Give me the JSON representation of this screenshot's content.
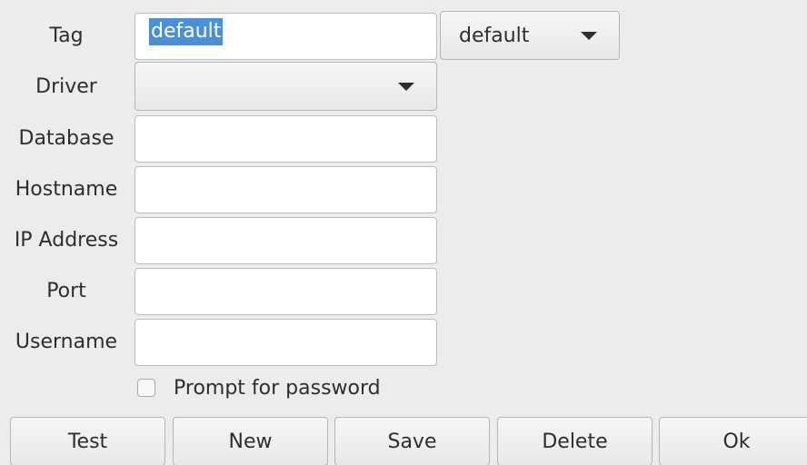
{
  "form": {
    "tag_label": "Tag",
    "tag_value": "default",
    "tag_selector_value": "default",
    "driver_label": "Driver",
    "driver_value": "",
    "database_label": "Database",
    "database_value": "",
    "hostname_label": "Hostname",
    "hostname_value": "",
    "ip_label": "IP Address",
    "ip_value": "",
    "port_label": "Port",
    "port_value": "",
    "username_label": "Username",
    "username_value": "",
    "prompt_password_label": "Prompt for password",
    "prompt_password_checked": false
  },
  "buttons": {
    "test": "Test",
    "new": "New",
    "save": "Save",
    "delete": "Delete",
    "ok": "Ok"
  },
  "colors": {
    "background": "#ececec",
    "selection": "#4a90d9"
  },
  "icons": {
    "dropdown": "chevron-down-icon"
  }
}
